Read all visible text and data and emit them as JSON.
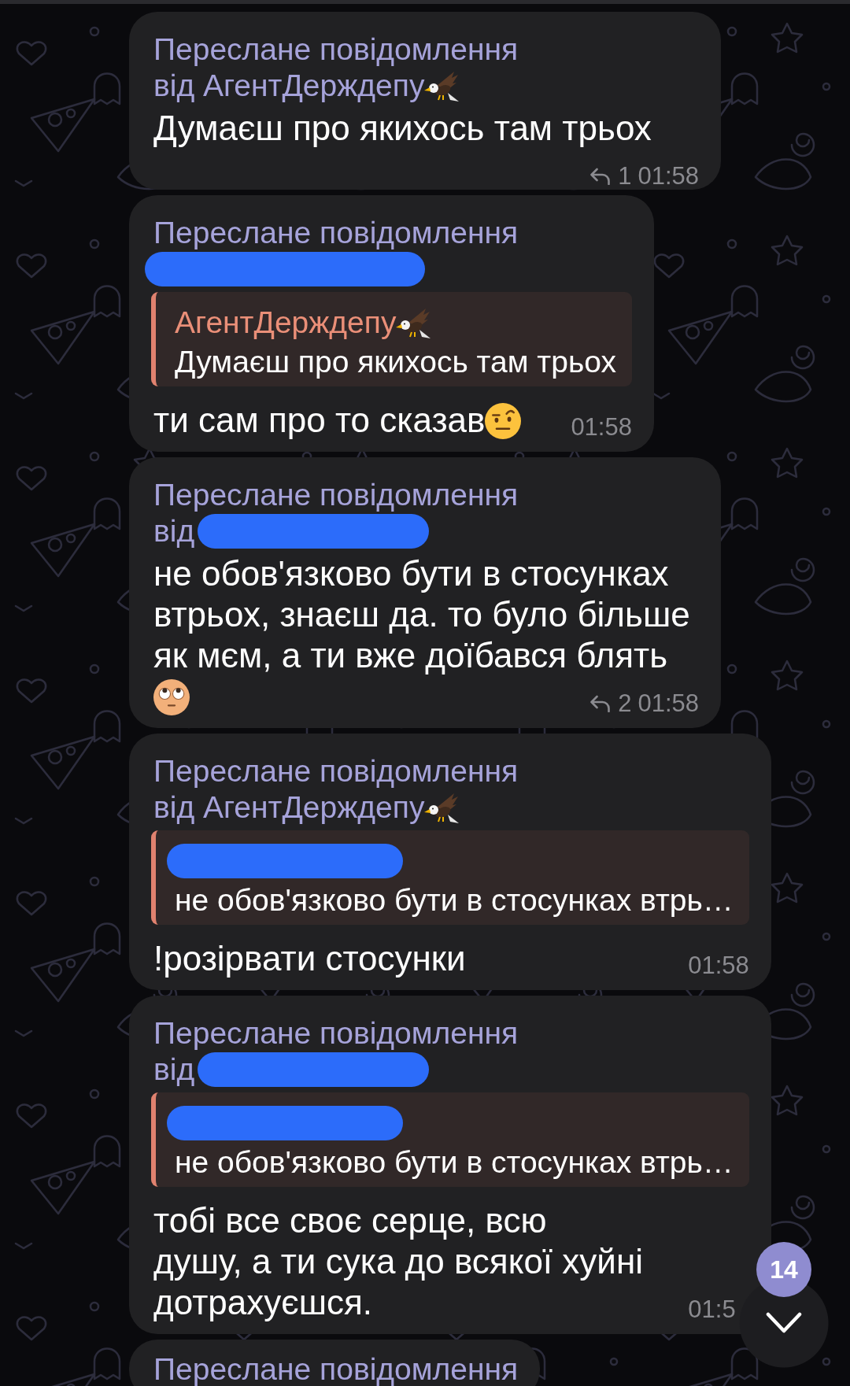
{
  "messages": [
    {
      "header": "Переслане повідомлення",
      "from": {
        "prefix": "від",
        "name": "АгентДерждепу",
        "name_emoji": true,
        "redacted": false
      },
      "text": "Думаєш про якихось там трьох",
      "replies": "1",
      "time": "01:58"
    },
    {
      "header": "Переслане повідомлення",
      "from": {
        "redacted": true
      },
      "quote": {
        "name": "АгентДерждепу",
        "name_emoji": true,
        "redacted": false,
        "text": "Думаєш про якихось там трьох"
      },
      "text": "ти сам про то сказав",
      "emoji": {
        "kind": "raised_eyebrow"
      },
      "time": "01:58"
    },
    {
      "header": "Переслане повідомлення",
      "from": {
        "prefix": "від",
        "redacted": true
      },
      "text": "не обов'язково бути в стосунках втрьох, знаєш да. то було більше як мєм, а ти вже доїбався блять",
      "emoji": {
        "kind": "eye_roll"
      },
      "replies": "2",
      "time": "01:58"
    },
    {
      "header": "Переслане повідомлення",
      "from": {
        "prefix": "від",
        "name": "АгентДерждепу",
        "name_emoji": true,
        "redacted": false
      },
      "quote": {
        "redacted": true,
        "text": "не обов'язково бути в стосунках втрь…"
      },
      "text": "!розірвати стосунки",
      "time": "01:58"
    },
    {
      "header": "Переслане повідомлення",
      "from": {
        "prefix": "від",
        "redacted": true
      },
      "quote": {
        "redacted": true,
        "text": "не обов'язково бути в стосунках втрь…"
      },
      "text": "тобі все своє серце, всю\nдушу, а ти сука до всякої хуйні\nдотрахуєшся.",
      "time": "01:5"
    },
    {
      "header": "Переслане повідомлення"
    }
  ],
  "scroll_button": {
    "unread_count": "14"
  }
}
